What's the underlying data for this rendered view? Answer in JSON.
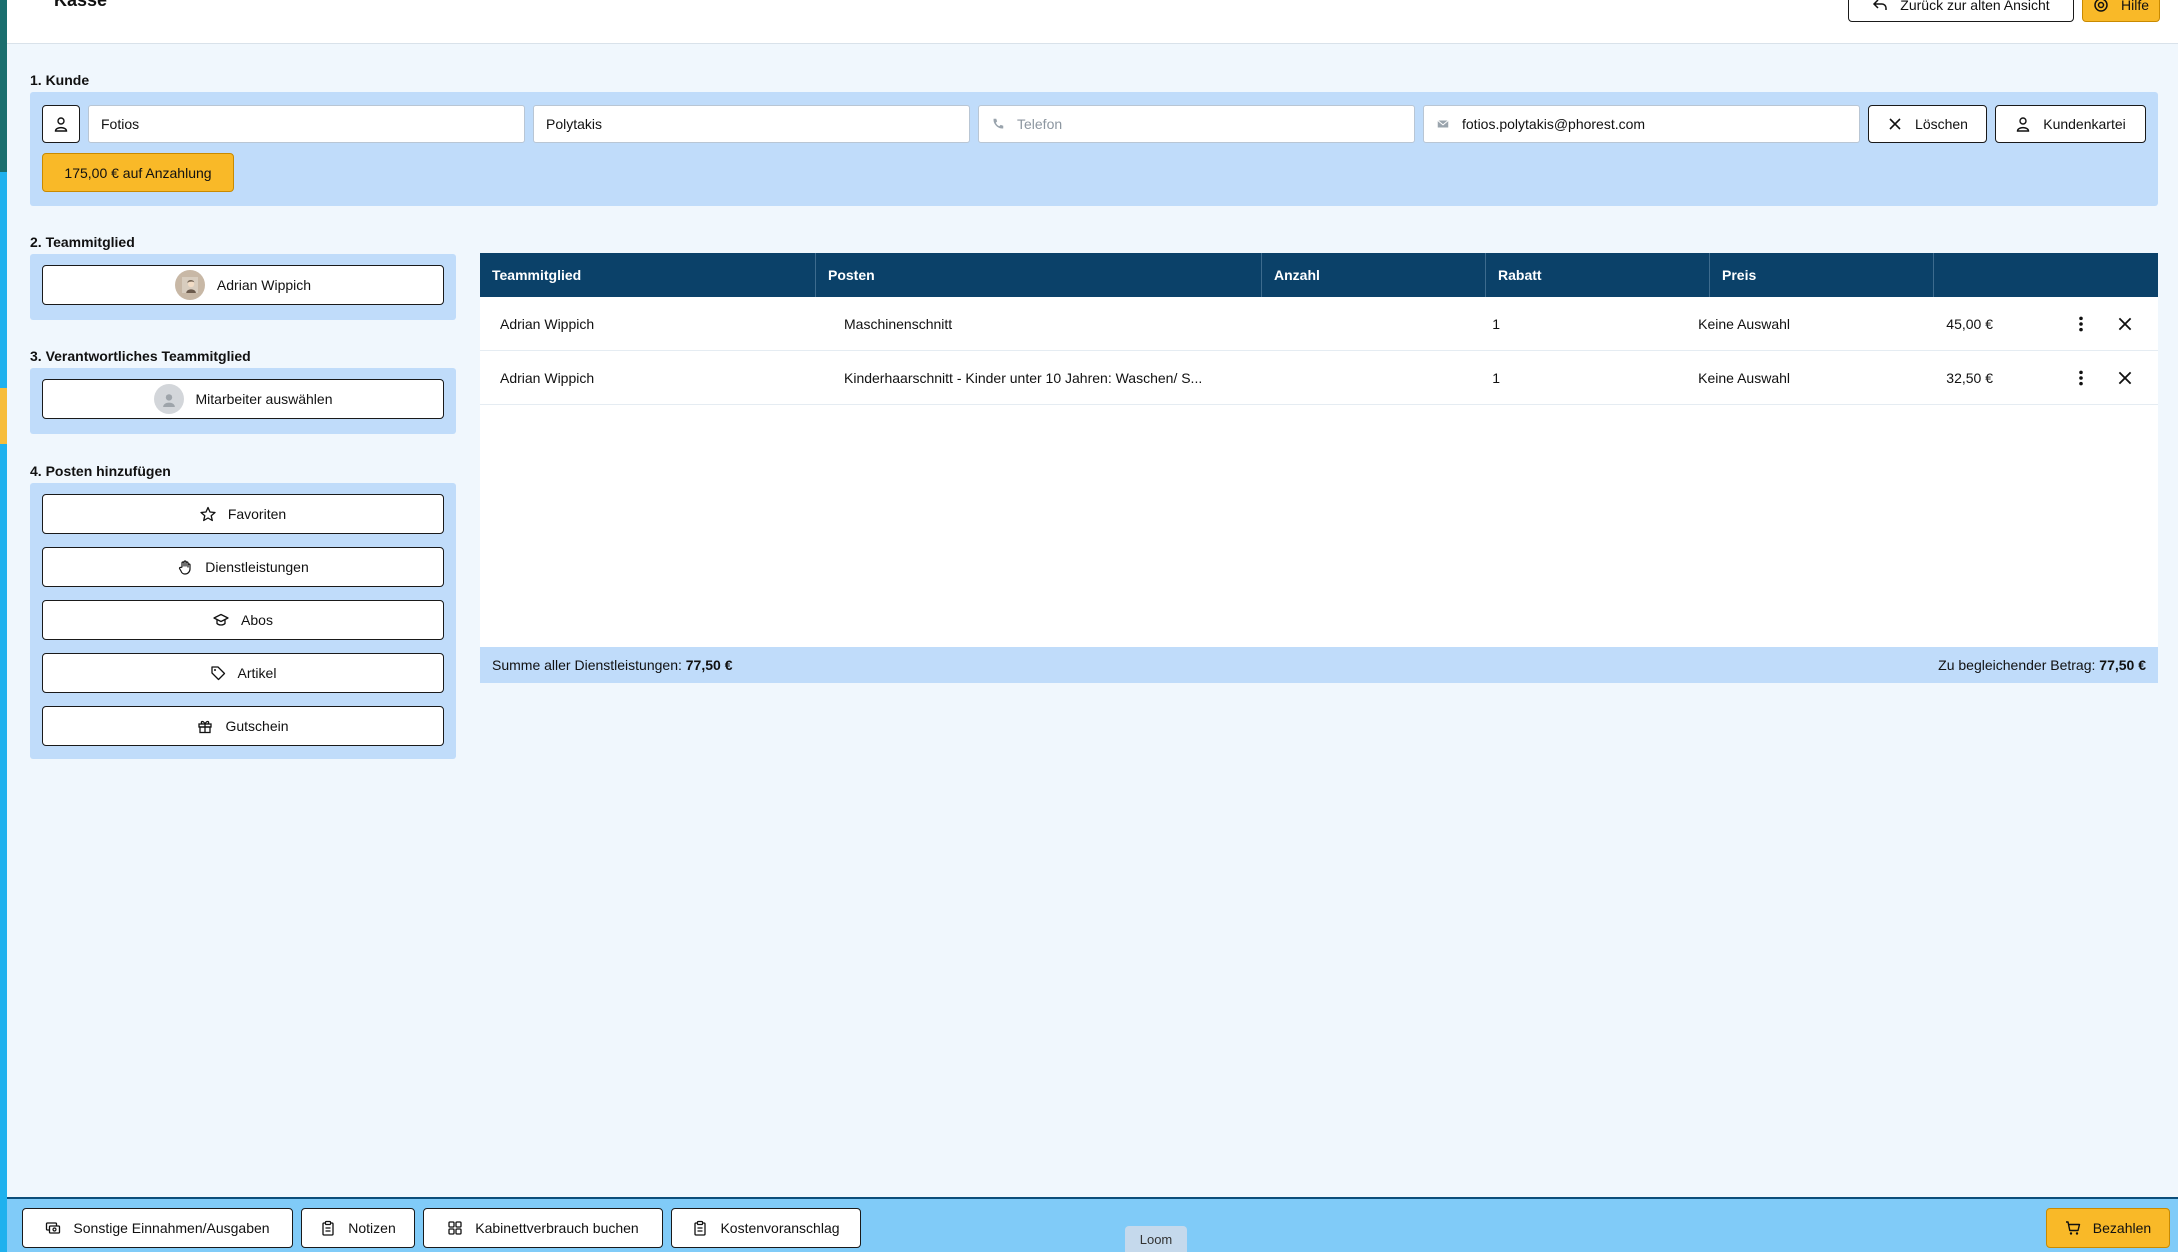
{
  "header": {
    "title": "Kasse",
    "back_label": "Zurück zur alten Ansicht",
    "help_label": "Hilfe"
  },
  "customer": {
    "section_label": "1. Kunde",
    "first_name": "Fotios",
    "last_name": "Polytakis",
    "phone_placeholder": "Telefon",
    "email": "fotios.polytakis@phorest.com",
    "clear_label": "Löschen",
    "file_label": "Kundenkartei",
    "deposit_label": "175,00 € auf Anzahlung"
  },
  "team_member": {
    "section_label": "2. Teammitglied",
    "name": "Adrian Wippich"
  },
  "responsible": {
    "section_label": "3. Verantwortliches Teammitglied",
    "select_label": "Mitarbeiter auswählen"
  },
  "add_items": {
    "section_label": "4. Posten hinzufügen",
    "buttons": [
      {
        "label": "Favoriten",
        "icon": "star-icon"
      },
      {
        "label": "Dienstleistungen",
        "icon": "hand-icon"
      },
      {
        "label": "Abos",
        "icon": "graduation-cap-icon"
      },
      {
        "label": "Artikel",
        "icon": "tag-icon"
      },
      {
        "label": "Gutschein",
        "icon": "gift-icon"
      }
    ]
  },
  "table": {
    "columns": [
      "Teammitglied",
      "Posten",
      "Anzahl",
      "Rabatt",
      "Preis"
    ],
    "rows": [
      {
        "member": "Adrian Wippich",
        "item": "Maschinenschnitt",
        "qty": "1",
        "discount": "Keine Auswahl",
        "price": "45,00 €"
      },
      {
        "member": "Adrian Wippich",
        "item": "Kinderhaarschnitt - Kinder unter 10 Jahren: Waschen/ S...",
        "qty": "1",
        "discount": "Keine Auswahl",
        "price": "32,50 €"
      }
    ],
    "sum_label": "Summe aller Dienstleistungen:",
    "sum_value": "77,50 €",
    "due_label": "Zu begleichender Betrag:",
    "due_value": "77,50 €"
  },
  "footer": {
    "other_label": "Sonstige Einnahmen/Ausgaben",
    "notes_label": "Notizen",
    "cabinet_label": "Kabinettverbrauch buchen",
    "estimate_label": "Kostenvoranschlag",
    "loom_label": "Loom",
    "pay_label": "Bezahlen"
  },
  "colors": {
    "accent_yellow": "#f9b928",
    "table_header": "#0b4169",
    "panel_blue": "#c0dcfa",
    "bottom_bar": "#80cbf8"
  }
}
